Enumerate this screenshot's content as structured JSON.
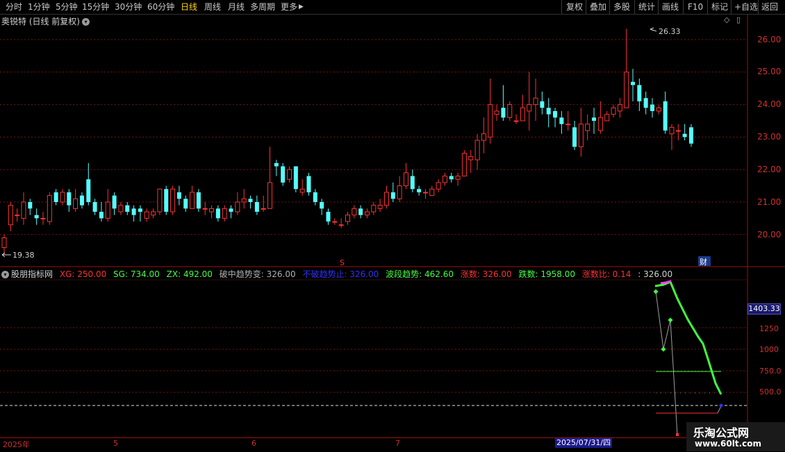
{
  "toolbar": {
    "periods": [
      "分时",
      "1分钟",
      "5分钟",
      "15分钟",
      "30分钟",
      "60分钟",
      "日线",
      "周线",
      "月线",
      "多周期",
      "更多"
    ],
    "active": "日线",
    "more_arrow": "▶",
    "tools": [
      "复权",
      "叠加",
      "多股",
      "统计",
      "画线",
      "F10",
      "标记",
      "+自选",
      "返回"
    ]
  },
  "main_chart": {
    "title": "奥锐特 (日线 前复权)",
    "title_icon": "chevron-down-icon",
    "yticks": [
      "26.00",
      "25.00",
      "24.00",
      "23.00",
      "22.00",
      "21.00",
      "20.00"
    ],
    "high_label": "26.33",
    "low_label": "19.38",
    "marker_s": "S",
    "marker_cai": "财",
    "up_color": "#ff3232",
    "down_color": "#54ffff"
  },
  "indicator": {
    "name": "股朋指标网",
    "items": [
      {
        "label": "XG: 250.00",
        "color": "#ff3030"
      },
      {
        "label": "SG: 734.00",
        "color": "#40ff40"
      },
      {
        "label": "ZX: 492.00",
        "color": "#40ff40"
      },
      {
        "label": "破中趋势变: 326.00",
        "color": "#b0b0b0"
      },
      {
        "label": "不破趋势止: 326.00",
        "color": "#3030ff"
      },
      {
        "label": "波段趋势: 462.60",
        "color": "#40ff40"
      },
      {
        "label": "涨数: 326.00",
        "color": "#ff3030"
      },
      {
        "label": "跌数: 1958.00",
        "color": "#40ff40"
      },
      {
        "label": "涨数比: 0.14",
        "color": "#ff3030"
      },
      {
        "label": ": 326.00",
        "color": "#d0d0d0"
      }
    ],
    "current_value": "1403.33",
    "yticks": [
      "1250",
      "1000",
      "750.0",
      "500.0"
    ]
  },
  "dates": {
    "labels": [
      "2025年",
      "5",
      "6",
      "7"
    ],
    "highlight": "2025/07/31/四"
  },
  "watermark": {
    "title": "乐淘公式网",
    "url": "www.60lt.com"
  }
}
